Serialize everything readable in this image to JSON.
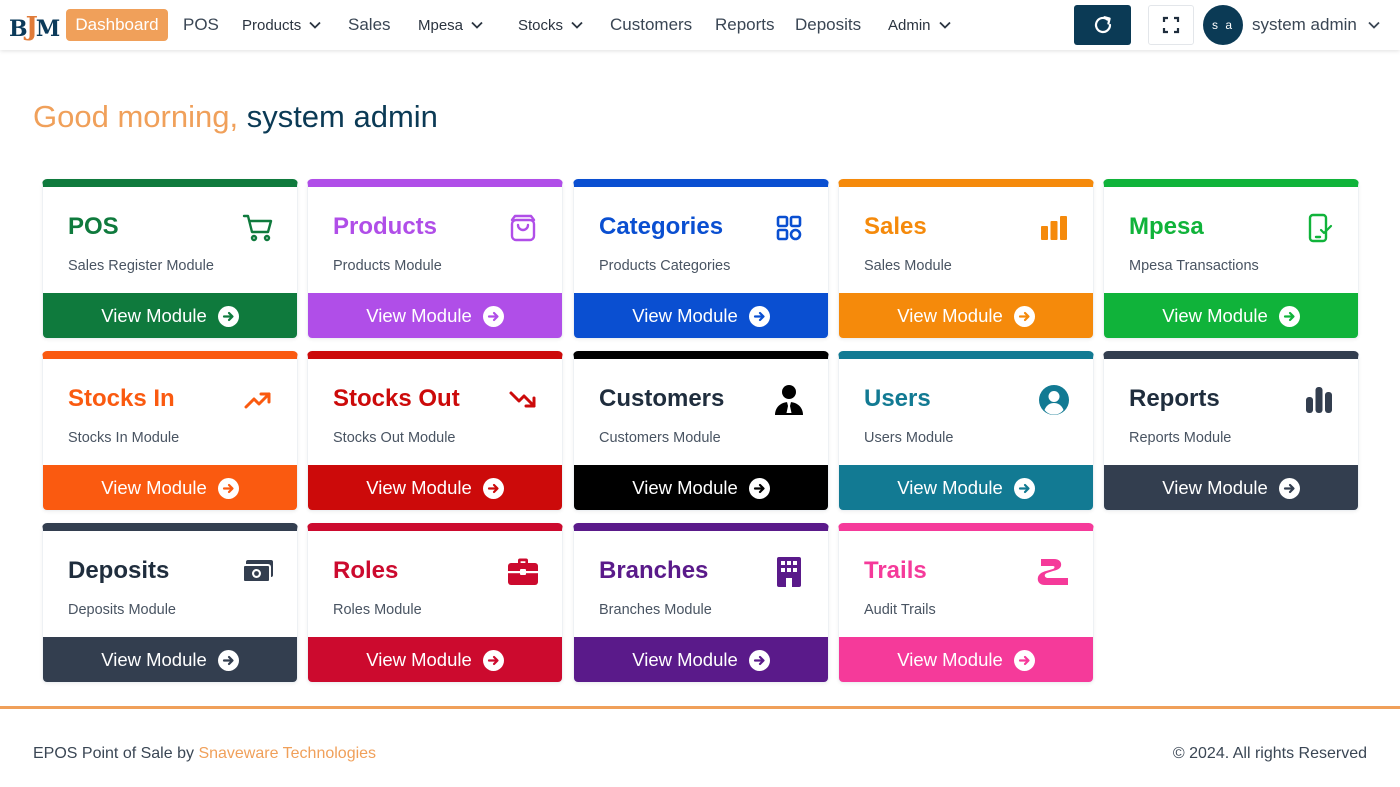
{
  "brand": {
    "logo_text": "BJM"
  },
  "nav": {
    "active": "Dashboard",
    "items": [
      {
        "label": "POS",
        "dropdown": false
      },
      {
        "label": "Products",
        "dropdown": true
      },
      {
        "label": "Sales",
        "dropdown": false
      },
      {
        "label": "Mpesa",
        "dropdown": true
      },
      {
        "label": "Stocks",
        "dropdown": true
      },
      {
        "label": "Customers",
        "dropdown": false
      },
      {
        "label": "Reports",
        "dropdown": false
      },
      {
        "label": "Deposits",
        "dropdown": false
      },
      {
        "label": "Admin",
        "dropdown": true
      }
    ]
  },
  "toolbar": {
    "refresh_icon": "refresh-icon",
    "fullscreen_icon": "fullscreen-icon"
  },
  "user": {
    "initials": "s a",
    "name": "system admin"
  },
  "greeting": {
    "salutation": "Good morning,",
    "name": "system admin"
  },
  "cards": [
    {
      "title": "POS",
      "subtitle": "Sales Register Module",
      "icon": "cart-icon",
      "color": "#0f7a3d",
      "button": "View Module"
    },
    {
      "title": "Products",
      "subtitle": "Products Module",
      "icon": "shopping-bag-icon",
      "color": "#b04ee8",
      "button": "View Module"
    },
    {
      "title": "Categories",
      "subtitle": "Products Categories",
      "icon": "grid-icon",
      "color": "#0a4fd1",
      "button": "View Module"
    },
    {
      "title": "Sales",
      "subtitle": "Sales Module",
      "icon": "bar-chart-icon",
      "color": "#f58a0b",
      "button": "View Module"
    },
    {
      "title": "Mpesa",
      "subtitle": "Mpesa Transactions",
      "icon": "phone-check-icon",
      "color": "#10b33a",
      "button": "View Module"
    },
    {
      "title": "Stocks In",
      "subtitle": "Stocks In Module",
      "icon": "trending-up-icon",
      "color": "#fa5a10",
      "button": "View Module"
    },
    {
      "title": "Stocks Out",
      "subtitle": "Stocks Out Module",
      "icon": "trending-down-icon",
      "color": "#cc0a0a",
      "button": "View Module"
    },
    {
      "title": "Customers",
      "subtitle": "Customers Module",
      "icon": "user-tie-icon",
      "color": "#000000",
      "button": "View Module"
    },
    {
      "title": "Users",
      "subtitle": "Users Module",
      "icon": "user-circle-icon",
      "color": "#127a93",
      "button": "View Module"
    },
    {
      "title": "Reports",
      "subtitle": "Reports Module",
      "icon": "column-chart-icon",
      "color": "#333e4f",
      "button": "View Module"
    },
    {
      "title": "Deposits",
      "subtitle": "Deposits Module",
      "icon": "money-icon",
      "color": "#333e4f",
      "button": "View Module"
    },
    {
      "title": "Roles",
      "subtitle": "Roles Module",
      "icon": "briefcase-icon",
      "color": "#cc0a2e",
      "button": "View Module"
    },
    {
      "title": "Branches",
      "subtitle": "Branches Module",
      "icon": "building-icon",
      "color": "#5a1a8a",
      "button": "View Module"
    },
    {
      "title": "Trails",
      "subtitle": "Audit Trails",
      "icon": "road-icon",
      "color": "#f53a9a",
      "button": "View Module"
    }
  ],
  "footer": {
    "prefix": "EPOS Point of Sale by",
    "company": "Snaveware Technologies",
    "copyright": "© 2024. All rights Reserved"
  }
}
